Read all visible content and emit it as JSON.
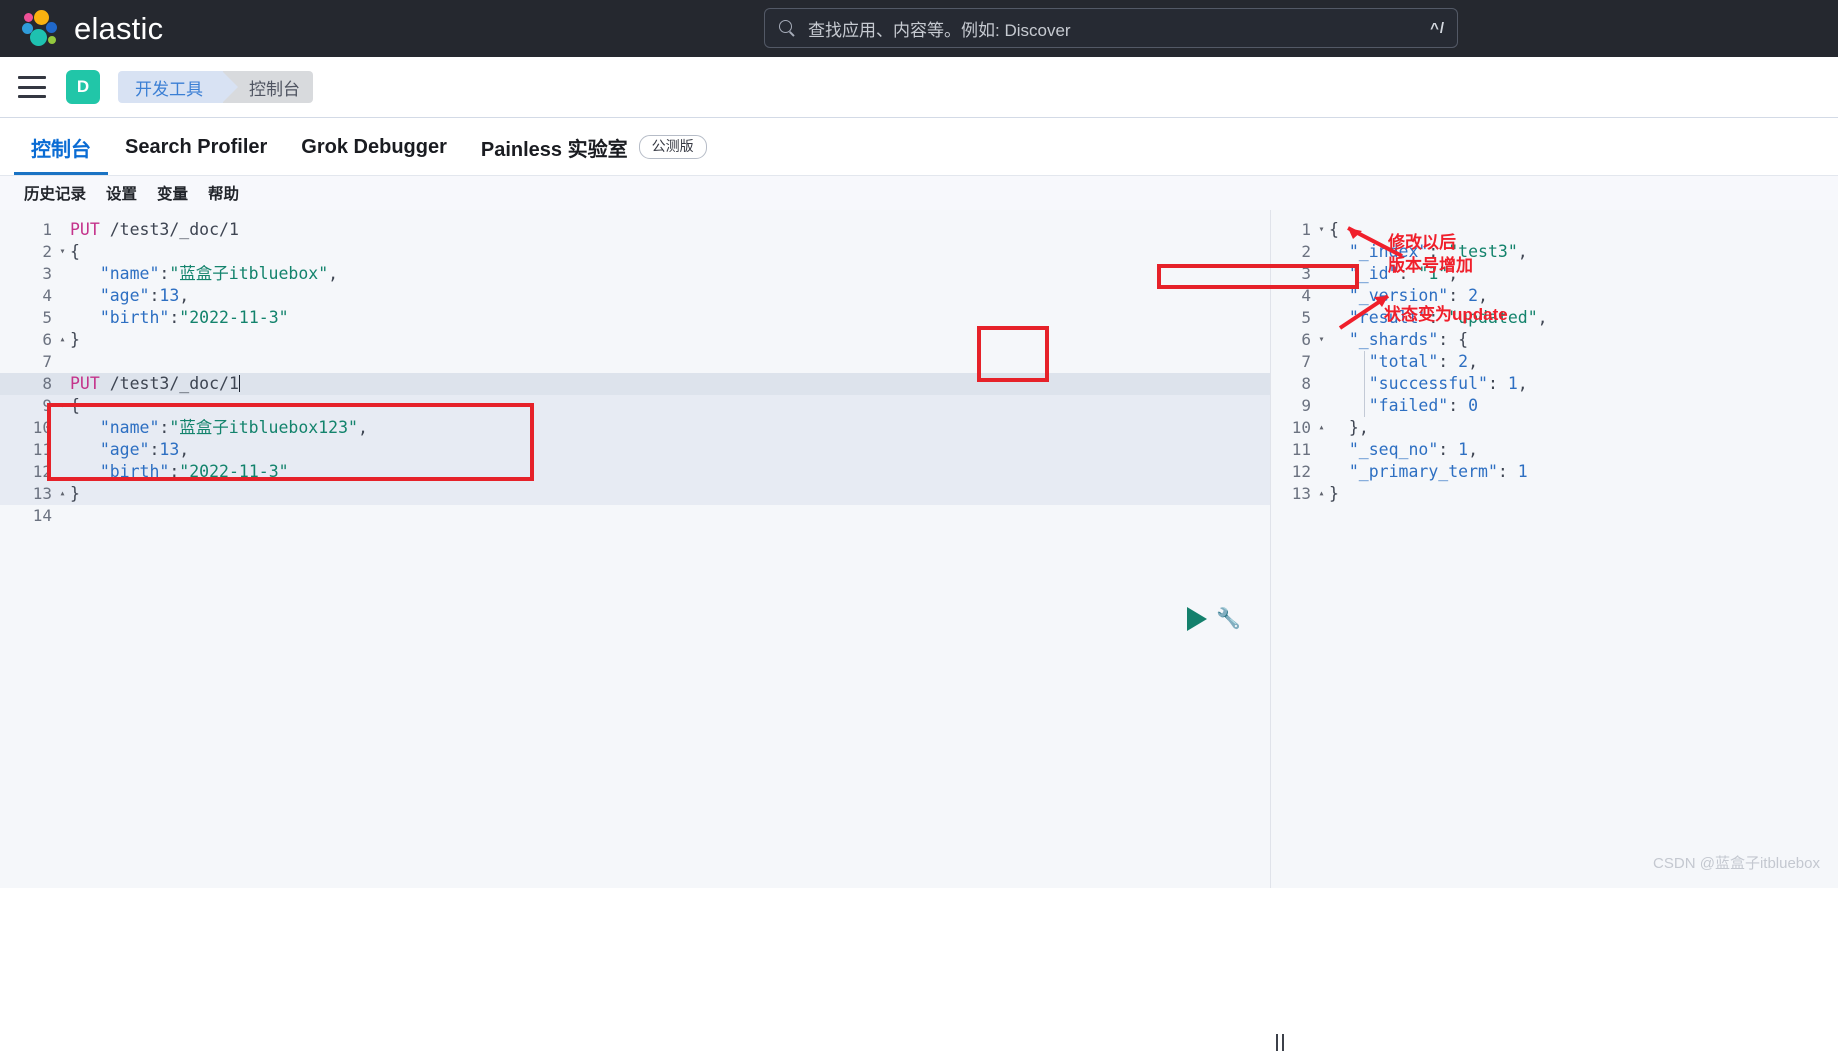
{
  "header": {
    "brand_name": "elastic",
    "search": {
      "placeholder": "查找应用、内容等。例如: Discover",
      "shortcut": "^/",
      "icon": "search-icon"
    }
  },
  "breadcrumb": {
    "menu_icon": "hamburger-menu-icon",
    "space_initial": "D",
    "items": [
      {
        "label": "开发工具"
      },
      {
        "label": "控制台"
      }
    ]
  },
  "tabs": [
    {
      "label": "控制台",
      "active": true,
      "badge": ""
    },
    {
      "label": "Search Profiler",
      "active": false,
      "badge": ""
    },
    {
      "label": "Grok Debugger",
      "active": false,
      "badge": ""
    },
    {
      "label": "Painless 实验室",
      "active": false,
      "badge": "公测版"
    }
  ],
  "submenu": [
    {
      "label": "历史记录"
    },
    {
      "label": "设置"
    },
    {
      "label": "变量"
    },
    {
      "label": "帮助"
    }
  ],
  "request_editor": {
    "lines": [
      {
        "n": "1",
        "fold": "",
        "text": "PUT /test3/_doc/1"
      },
      {
        "n": "2",
        "fold": "▾",
        "text": "{"
      },
      {
        "n": "3",
        "fold": "",
        "text": "   \"name\":\"蓝盒子itbluebox\","
      },
      {
        "n": "4",
        "fold": "",
        "text": "   \"age\":13,"
      },
      {
        "n": "5",
        "fold": "",
        "text": "   \"birth\":\"2022-11-3\""
      },
      {
        "n": "6",
        "fold": "▴",
        "text": "}"
      },
      {
        "n": "7",
        "fold": "",
        "text": ""
      },
      {
        "n": "8",
        "fold": "",
        "text": "PUT /test3/_doc/1"
      },
      {
        "n": "9",
        "fold": "▾",
        "text": "{"
      },
      {
        "n": "10",
        "fold": "",
        "text": "   \"name\":\"蓝盒子itbluebox123\","
      },
      {
        "n": "11",
        "fold": "",
        "text": "   \"age\":13,"
      },
      {
        "n": "12",
        "fold": "",
        "text": "   \"birth\":\"2022-11-3\""
      },
      {
        "n": "13",
        "fold": "▴",
        "text": "}"
      },
      {
        "n": "14",
        "fold": "",
        "text": ""
      }
    ],
    "play_button": "send-request-play-button",
    "wrench_button": "request-options-wrench-icon"
  },
  "response_viewer": {
    "lines": [
      {
        "n": "1",
        "fold": "▾",
        "text": "{"
      },
      {
        "n": "2",
        "fold": "",
        "text": "  \"_index\": \"test3\","
      },
      {
        "n": "3",
        "fold": "",
        "text": "  \"_id\": \"1\","
      },
      {
        "n": "4",
        "fold": "",
        "text": "  \"_version\": 2,"
      },
      {
        "n": "5",
        "fold": "",
        "text": "  \"result\": \"updated\","
      },
      {
        "n": "6",
        "fold": "▾",
        "text": "  \"_shards\": {"
      },
      {
        "n": "7",
        "fold": "",
        "text": "    \"total\": 2,"
      },
      {
        "n": "8",
        "fold": "",
        "text": "    \"successful\": 1,"
      },
      {
        "n": "9",
        "fold": "",
        "text": "    \"failed\": 0"
      },
      {
        "n": "10",
        "fold": "▴",
        "text": "  },"
      },
      {
        "n": "11",
        "fold": "",
        "text": "  \"_seq_no\": 1,"
      },
      {
        "n": "12",
        "fold": "",
        "text": "  \"_primary_term\": 1"
      },
      {
        "n": "13",
        "fold": "▴",
        "text": "}"
      }
    ]
  },
  "annotations": {
    "color": "#f01f2b",
    "note_version": "修改以后\n版本号增加",
    "note_result": "状态变为update"
  },
  "watermark": "CSDN @蓝盒子itbluebox"
}
